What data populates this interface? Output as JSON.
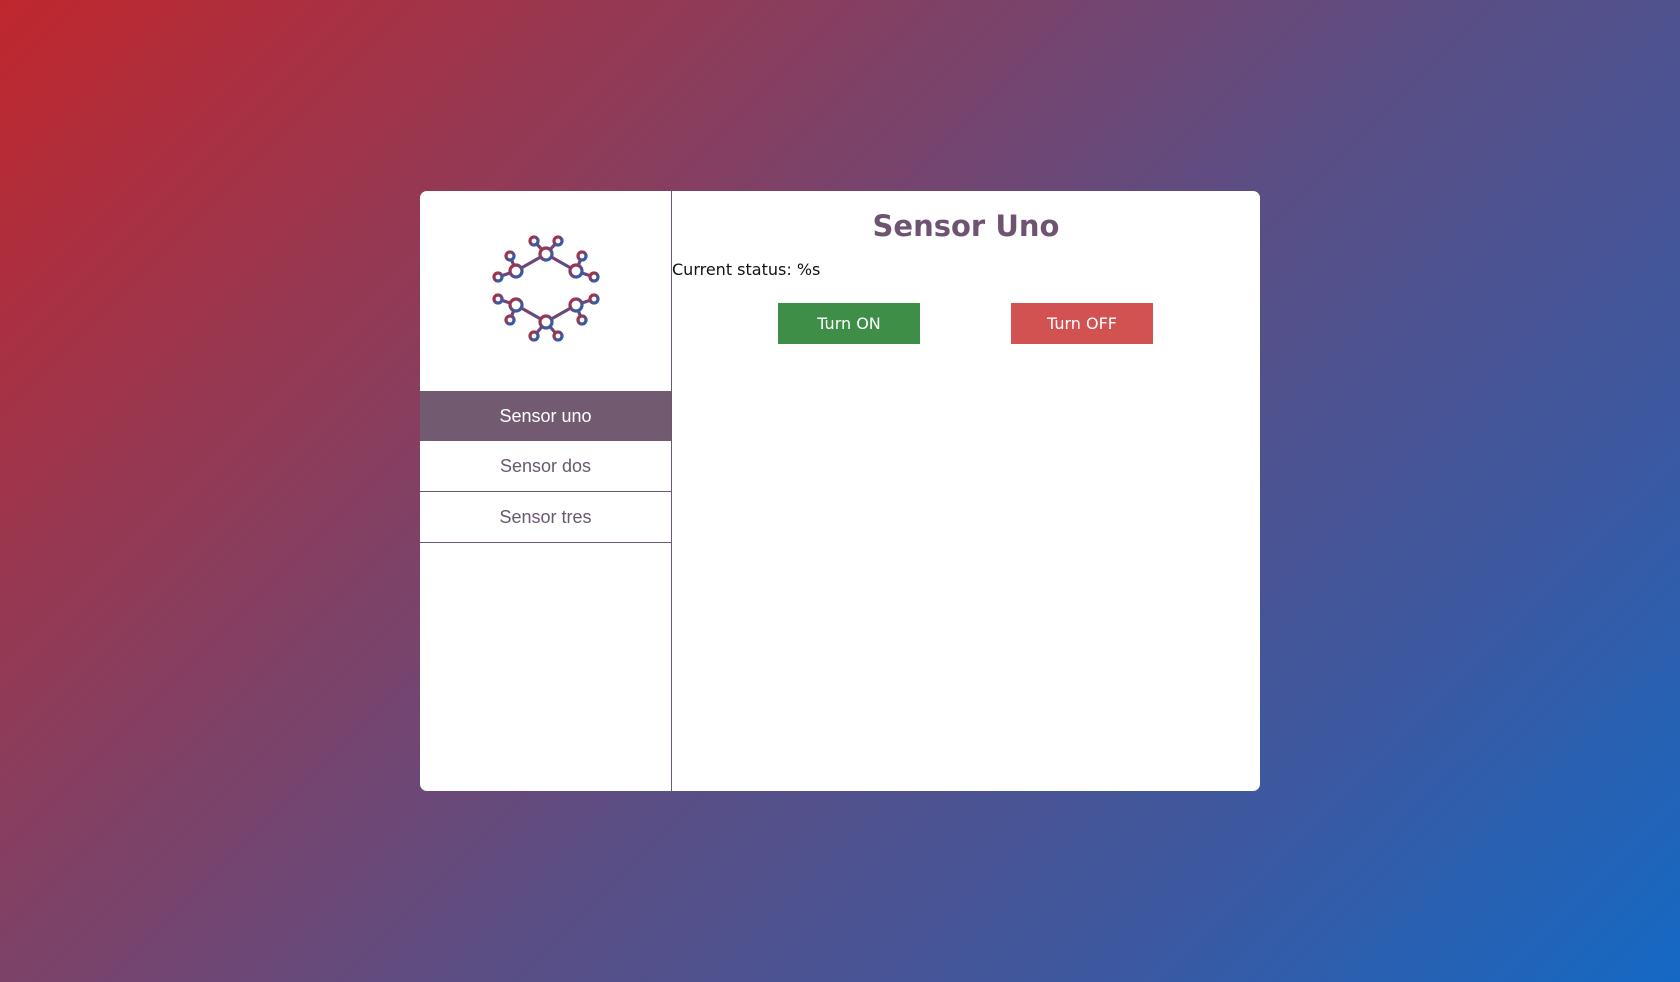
{
  "sidebar": {
    "logo_icon": "network-hub-icon",
    "items": [
      {
        "label": "Sensor uno",
        "active": true
      },
      {
        "label": "Sensor dos",
        "active": false
      },
      {
        "label": "Sensor tres",
        "active": false
      }
    ]
  },
  "main": {
    "title": "Sensor Uno",
    "status_text": "Current status: %s",
    "turn_on_label": "Turn ON",
    "turn_off_label": "Turn OFF"
  },
  "colors": {
    "accent": "#725a70",
    "on_button": "#3e8e47",
    "off_button": "#d25252",
    "gradient_start": "#c0272d",
    "gradient_end": "#1469c4"
  }
}
